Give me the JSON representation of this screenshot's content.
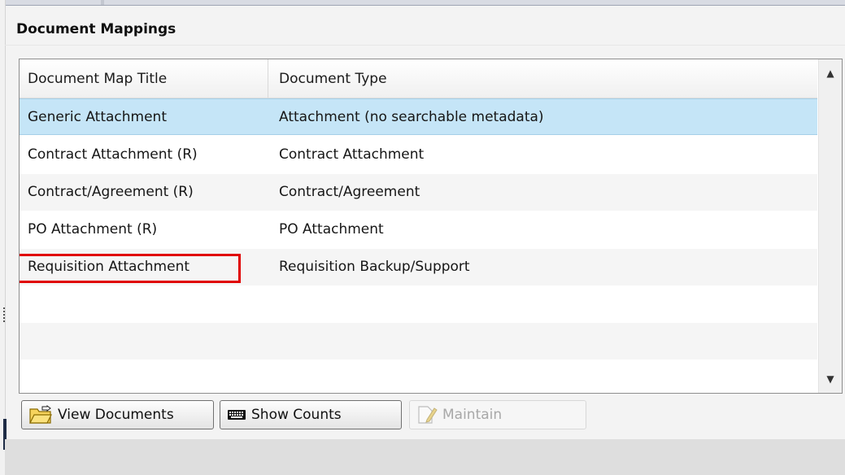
{
  "panel": {
    "title": "Document Mappings"
  },
  "grid": {
    "columns": [
      "Document Map Title",
      "Document Type"
    ],
    "rows": [
      {
        "title": "Generic Attachment",
        "type": "Attachment (no searchable metadata)"
      },
      {
        "title": "Contract Attachment (R)",
        "type": "Contract Attachment"
      },
      {
        "title": "Contract/Agreement (R)",
        "type": "Contract/Agreement"
      },
      {
        "title": "PO Attachment (R)",
        "type": "PO Attachment"
      },
      {
        "title": "Requisition Attachment",
        "type": "Requisition Backup/Support"
      }
    ],
    "selected_row_index": 0,
    "highlighted_row_index": 4
  },
  "toolbar": {
    "view_documents_label": "View Documents",
    "show_counts_label": "Show Counts",
    "maintain_label": "Maintain"
  },
  "colors": {
    "selected_row": "#c5e5f7",
    "highlight_box": "#e00000"
  },
  "icons": {
    "view_documents": "folder-open-icon",
    "show_counts": "keyboard-icon",
    "maintain": "edit-document-icon",
    "scroll_up": "triangle-up-icon",
    "scroll_down": "triangle-down-icon"
  }
}
